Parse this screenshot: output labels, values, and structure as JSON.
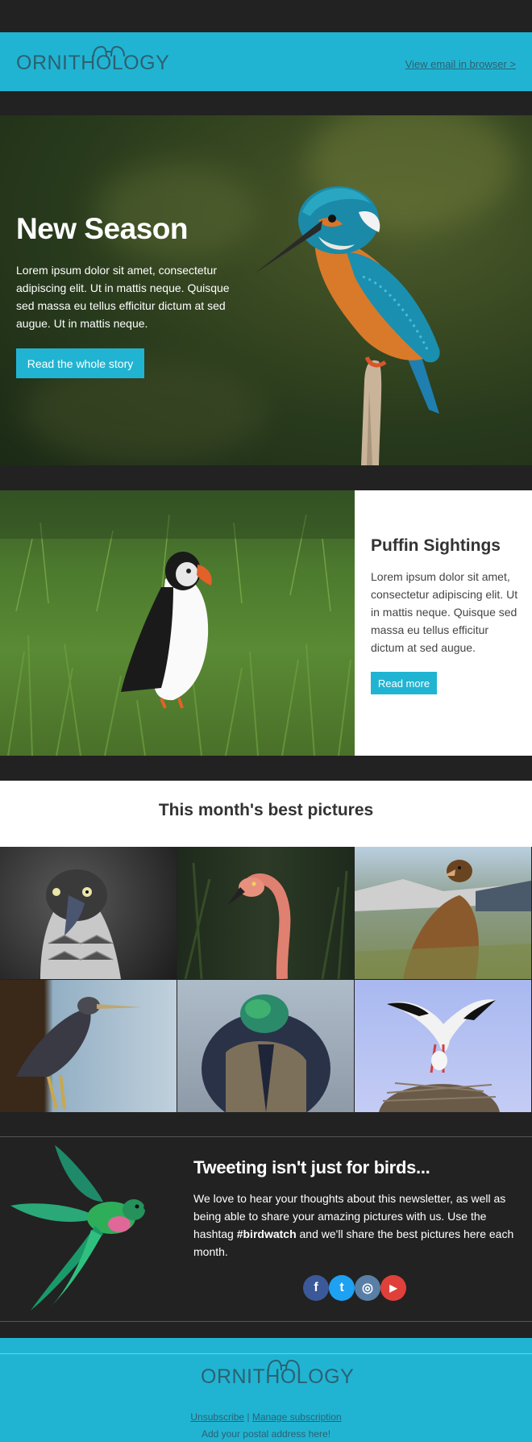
{
  "header": {
    "logo_text": "ORNITHOLOGY",
    "view_in_browser": "View email in browser >"
  },
  "hero": {
    "title": "New Season",
    "text": "Lorem ipsum dolor sit amet, consectetur adipiscing elit. Ut in mattis neque. Quisque sed massa eu tellus efficitur dictum at sed augue. Ut in mattis neque.",
    "button": "Read the whole story"
  },
  "puffin": {
    "title": "Puffin Sightings",
    "text": "Lorem ipsum dolor sit amet, consectetur adipiscing elit. Ut in mattis neque. Quisque sed massa eu tellus efficitur dictum at sed augue.",
    "button": "Read more"
  },
  "pictures": {
    "title": "This month's best pictures"
  },
  "tweet": {
    "title": "Tweeting isn't just for birds...",
    "text_before": "We love to hear your thoughts about this newsletter, as well as being able to share your amazing pictures with us. Use the hashtag ",
    "hashtag": "#birdwatch",
    "text_after": " and we'll share the best pictures here each month.",
    "social": [
      {
        "name": "facebook-icon",
        "glyph": "f",
        "color": "#3b5998"
      },
      {
        "name": "twitter-icon",
        "glyph": "t",
        "color": "#1da1f2"
      },
      {
        "name": "instagram-icon",
        "glyph": "◎",
        "color": "#5a7fa6"
      },
      {
        "name": "youtube-icon",
        "glyph": "▶",
        "color": "#e0403a"
      }
    ]
  },
  "footer": {
    "logo_text": "ORNITHOLOGY",
    "unsubscribe": "Unsubscribe",
    "separator": "|",
    "manage": "Manage subscription",
    "address": "Add your postal address here!"
  },
  "colors": {
    "accent": "#21b4d2",
    "dark": "#222222",
    "logo": "#2b6173"
  }
}
